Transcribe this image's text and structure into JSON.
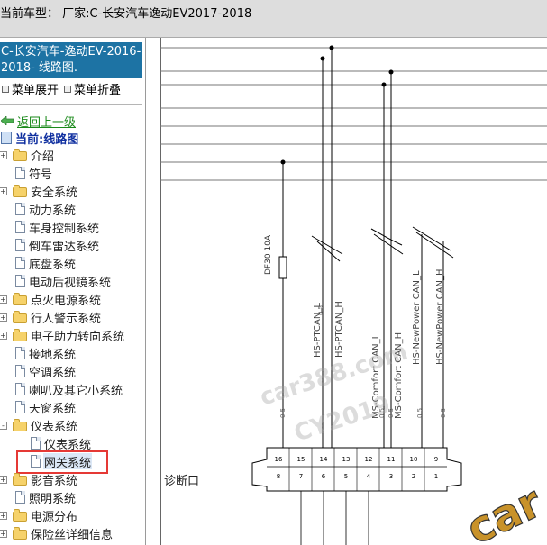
{
  "header": {
    "title": "当前车型：  厂家:C-长安汽车逸动EV2017-2018"
  },
  "sidebar": {
    "vehicle_title_line1": "C-长安汽车-逸动EV-2016-",
    "vehicle_title_line2": "2018- 线路图.",
    "expand_label": "菜单展开",
    "collapse_label": "菜单折叠",
    "back_label": "返回上一级",
    "current_label": "当前:线路图",
    "items": [
      {
        "label": "介绍"
      },
      {
        "label": "符号"
      },
      {
        "label": "安全系统"
      },
      {
        "label": "动力系统"
      },
      {
        "label": "车身控制系统"
      },
      {
        "label": "倒车雷达系统"
      },
      {
        "label": "底盘系统"
      },
      {
        "label": "电动后视镜系统"
      },
      {
        "label": "点火电源系统"
      },
      {
        "label": "行人警示系统"
      },
      {
        "label": "电子助力转向系统"
      },
      {
        "label": "接地系统"
      },
      {
        "label": "空调系统"
      },
      {
        "label": "喇叭及其它小系统"
      },
      {
        "label": "天窗系统"
      },
      {
        "label": "仪表系统"
      },
      {
        "label": "仪表系统"
      },
      {
        "label": "网关系统"
      },
      {
        "label": "影音系统"
      },
      {
        "label": "照明系统"
      },
      {
        "label": "电源分布"
      },
      {
        "label": "保险丝详细信息"
      }
    ]
  },
  "diagram": {
    "fuse_label": "DF30 10A",
    "wire_labels": [
      "HS-PTCAN_L",
      "HS-PTCAN_H",
      "MS-Comfort CAN_L",
      "MS-Comfort CAN_H",
      "HS-NewPower CAN_L",
      "HS-NewPower CAN_H"
    ],
    "wire_gauges": [
      "0.5",
      "0.5",
      "0.5",
      "0.5",
      "0.5",
      "0.5"
    ],
    "connector_top_pins": [
      "16",
      "15",
      "14",
      "13",
      "12",
      "11",
      "10",
      "9"
    ],
    "connector_bottom_pins": [
      "8",
      "7",
      "6",
      "5",
      "4",
      "3",
      "2",
      "1"
    ],
    "connector_label": "诊断口",
    "watermark1": "car388.com",
    "watermark2": "CY2019",
    "watermark3": "car"
  }
}
